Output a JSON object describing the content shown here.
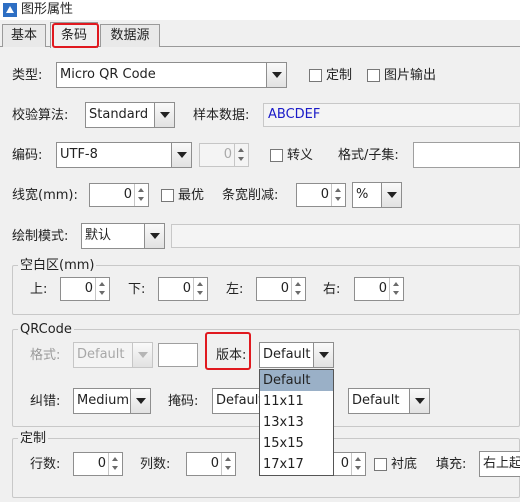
{
  "window": {
    "title": "图形属性"
  },
  "tabs": [
    {
      "label": "基本"
    },
    {
      "label": "条码"
    },
    {
      "label": "数据源"
    }
  ],
  "type_row": {
    "label": "类型:",
    "value": "Micro QR Code",
    "custom_label": "定制",
    "image_output_label": "图片输出"
  },
  "check_row": {
    "label": "校验算法:",
    "value": "Standard",
    "sample_label": "样本数据:",
    "sample_value": "ABCDEF"
  },
  "encoding_row": {
    "label": "编码:",
    "value": "UTF-8",
    "spin_value": "0",
    "escape_label": "转义",
    "format_label": "格式/子集:"
  },
  "width_row": {
    "label": "线宽(mm):",
    "width_value": "0",
    "best_label": "最优",
    "reduce_label": "条宽削减:",
    "reduce_value": "0",
    "unit_value": "%"
  },
  "draw_row": {
    "label": "绘制模式:",
    "value": "默认"
  },
  "margin_group": {
    "title": "空白区(mm)",
    "top_label": "上:",
    "top_value": "0",
    "bottom_label": "下:",
    "bottom_value": "0",
    "left_label": "左:",
    "left_value": "0",
    "right_label": "右:",
    "right_value": "0"
  },
  "qr_group": {
    "title": "QRCode",
    "format_label": "格式:",
    "format_value": "Default",
    "version_label": "版本:",
    "version_value": "Default",
    "ecc_label": "纠错:",
    "ecc_value": "Medium",
    "mask_label": "掩码:",
    "mask_value": "Default",
    "extra_value": "Default"
  },
  "version_dropdown": {
    "options": [
      "Default",
      "11x11",
      "13x13",
      "15x15",
      "17x17"
    ],
    "selected": "Default"
  },
  "custom_group": {
    "title": "定制",
    "rows_label": "行数:",
    "rows_value": "0",
    "cols_label": "列数:",
    "cols_value": "0",
    "cover_value": "0",
    "background_label": "衬底",
    "fill_label": "填充:",
    "fill_value": "右上起"
  },
  "colors": {
    "highlight": "#e0191f",
    "selection": "#9ab0c7",
    "sample_text": "#1a1ac8"
  }
}
